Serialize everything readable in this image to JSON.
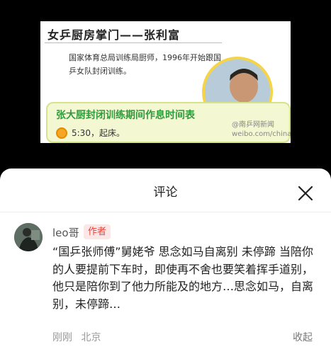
{
  "infographic": {
    "title": "女乒厨房掌门——张利富",
    "description": "国家体育总局训练局厨师，1996年开始跟国乒女队封闭训练。",
    "box_title": "张大厨封闭训练期间作息时间表",
    "first_item": "5:30，起床。",
    "watermark_line1": "@南乒网新闻",
    "watermark_line2": "weibo.com/chinattcc"
  },
  "sheet": {
    "title": "评论",
    "close_icon": "close-icon"
  },
  "comment": {
    "username": "leo哥",
    "badge": "作者",
    "text": "“国乒张师傅”舅姥爷 思念如马自离别 未停蹄 当陪你的人要提前下车时，即使再不舍也要笑着挥手道别，他只是陪你到了他力所能及的地方…思念如马，自离别，未停蹄…",
    "time": "刚刚",
    "location": "北京",
    "collapse_label": "收起"
  },
  "colors": {
    "badge_bg": "#fde7e6",
    "badge_text": "#e0483f",
    "box_title": "#2f9b3b",
    "portrait_border": "#f5d547"
  }
}
